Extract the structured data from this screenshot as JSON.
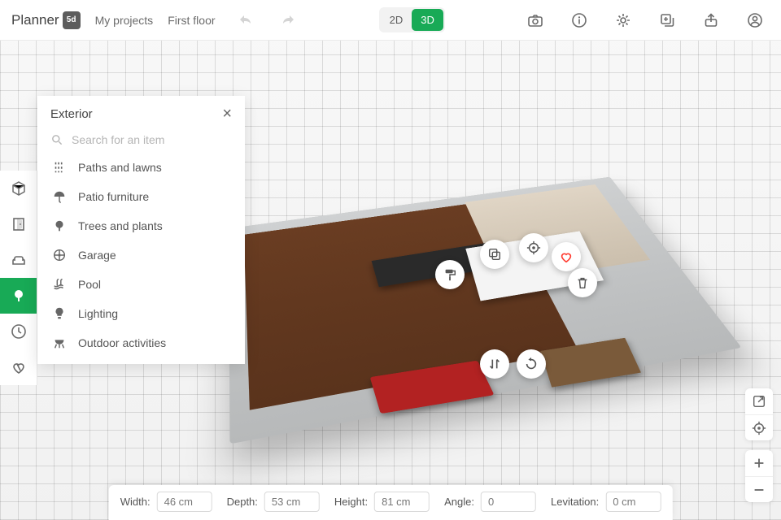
{
  "app": {
    "logo_text": "Planner",
    "logo_badge": "5d"
  },
  "topbar": {
    "my_projects": "My projects",
    "floor_label": "First floor",
    "view2d": "2D",
    "view3d": "3D"
  },
  "catalog": {
    "title": "Exterior",
    "search_placeholder": "Search for an item",
    "items": [
      {
        "label": "Paths and lawns",
        "icon": "paths"
      },
      {
        "label": "Patio furniture",
        "icon": "umbrella"
      },
      {
        "label": "Trees and plants",
        "icon": "tree"
      },
      {
        "label": "Garage",
        "icon": "wheel"
      },
      {
        "label": "Pool",
        "icon": "pool"
      },
      {
        "label": "Lighting",
        "icon": "bulb"
      },
      {
        "label": "Outdoor activities",
        "icon": "grill"
      }
    ]
  },
  "tool_rail": [
    {
      "name": "3d-cube-tool",
      "icon": "cube"
    },
    {
      "name": "door-tool",
      "icon": "door"
    },
    {
      "name": "furniture-tool",
      "icon": "sofa"
    },
    {
      "name": "exterior-tool",
      "icon": "tree",
      "active": true
    },
    {
      "name": "history-tool",
      "icon": "clock"
    },
    {
      "name": "favorite-tool",
      "icon": "heart-broken"
    }
  ],
  "context_controls": [
    {
      "name": "paint-button",
      "icon": "roller"
    },
    {
      "name": "copy-button",
      "icon": "copy"
    },
    {
      "name": "target-button",
      "icon": "target"
    },
    {
      "name": "favorite-button",
      "icon": "heart"
    },
    {
      "name": "delete-button",
      "icon": "trash"
    },
    {
      "name": "flip-button",
      "icon": "swap"
    },
    {
      "name": "rotate-button",
      "icon": "rotate"
    }
  ],
  "dimensions": {
    "width_label": "Width:",
    "width_value": "46 cm",
    "depth_label": "Depth:",
    "depth_value": "53 cm",
    "height_label": "Height:",
    "height_value": "81 cm",
    "angle_label": "Angle:",
    "angle_value": "0",
    "lev_label": "Levitation:",
    "lev_value": "0 cm"
  },
  "side_controls": {
    "a": [
      "open-external",
      "recenter"
    ],
    "b": [
      "zoom-in",
      "zoom-out"
    ]
  },
  "colors": {
    "accent": "#18aa56"
  }
}
